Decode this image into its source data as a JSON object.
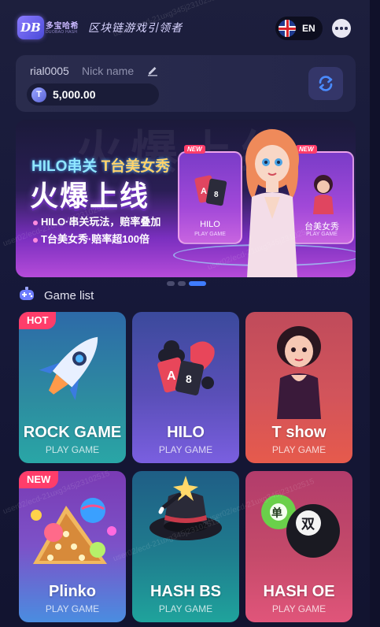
{
  "header": {
    "logo_mark": "DB",
    "logo_name": "多宝哈希",
    "logo_name_sub": "DUOBAO HASH",
    "slogan": "区块链游戏引领者",
    "language_label": "EN",
    "language_icon": "uk-flag-icon",
    "more_icon": "more-dots-icon"
  },
  "user": {
    "username": "rial0005",
    "nickname_placeholder": "Nick name",
    "balance": "5,000.00",
    "coin_symbol": "T",
    "refresh_icon": "refresh-icon"
  },
  "banner": {
    "title_part1": "HILO串关",
    "title_part2": "T台美女秀",
    "headline": "火爆上线",
    "line1": "HILO·串关玩法，赔率叠加",
    "line2": "T台美女秀·赔率超100倍",
    "card1": {
      "tag": "NEW",
      "label": "HILO",
      "sub": "PLAY GAME"
    },
    "card2": {
      "tag": "NEW",
      "label": "台美女秀",
      "sub": "PLAY GAME"
    },
    "bg_text": "火爆上线"
  },
  "carousel": {
    "count": 3,
    "active_index": 2
  },
  "game_list": {
    "title": "Game list",
    "games": [
      {
        "name": "ROCK GAME",
        "sub": "PLAY GAME",
        "tag": "HOT",
        "icon": "rocket-icon"
      },
      {
        "name": "HILO",
        "sub": "PLAY GAME",
        "tag": "",
        "icon": "poker-cards-icon"
      },
      {
        "name": "T show",
        "sub": "PLAY GAME",
        "tag": "",
        "icon": "showgirl-icon"
      },
      {
        "name": "Plinko",
        "sub": "PLAY GAME",
        "tag": "NEW",
        "icon": "plinko-balls-icon"
      },
      {
        "name": "HASH BS",
        "sub": "PLAY GAME",
        "tag": "",
        "icon": "magic-hat-icon"
      },
      {
        "name": "HASH OE",
        "sub": "PLAY GAME",
        "tag": "",
        "icon": "odd-even-balls-icon"
      }
    ]
  },
  "watermark": "user02/ecd-21uxg345j23102515",
  "colors": {
    "accent": "#3f7cff",
    "tag_red": "#ff3d6a",
    "background": "#17193a"
  }
}
